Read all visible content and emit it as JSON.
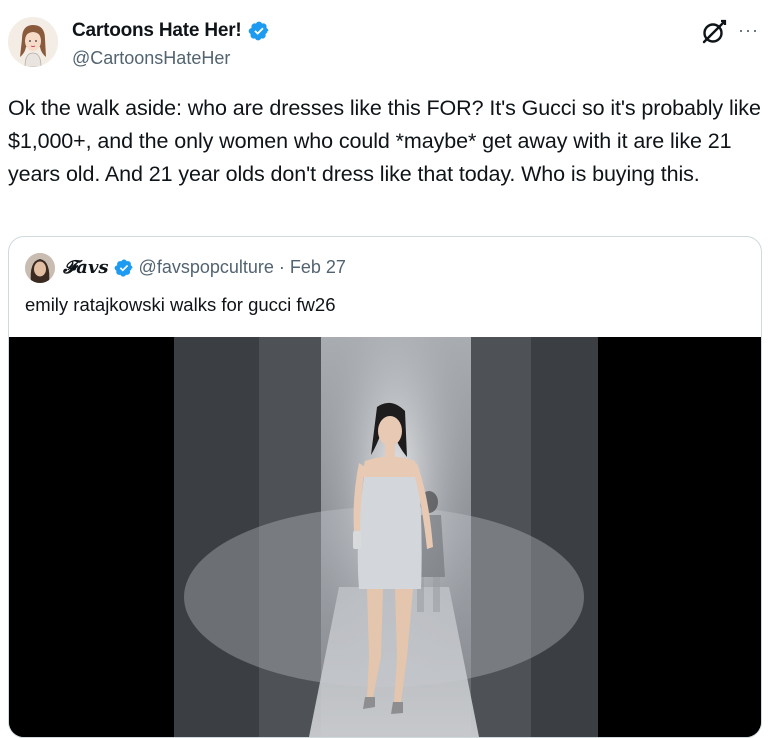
{
  "tweet": {
    "display_name": "Cartoons Hate Her!",
    "handle": "@CartoonsHateHer",
    "verified": true,
    "text": "Ok the walk aside: who are dresses like this FOR? It's Gucci so it's probably like $1,000+, and the only women who could *maybe* get away with it are like 21 years old. And 21 year olds don't dress like that today. Who is buying this.",
    "icons": {
      "grok": "grok-icon",
      "more": "more-options-icon",
      "verified": "verified-badge-icon"
    },
    "more_label": "···"
  },
  "quote": {
    "display_name": "𝓕avs",
    "handle": "@favspopculture",
    "separator": "·",
    "date": "Feb 27",
    "verified": true,
    "text": "emily ratajkowski walks for gucci fw26"
  },
  "colors": {
    "verified": "#1d9bf0",
    "secondary_text": "#536471",
    "border": "#cfd9de"
  }
}
